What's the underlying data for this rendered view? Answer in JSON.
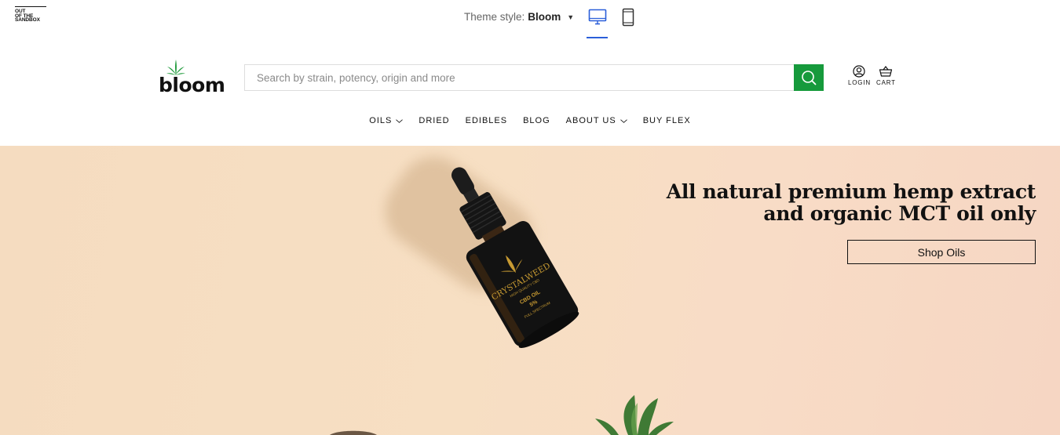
{
  "theme_bar": {
    "logo_lines": [
      "OUT",
      "OF THE",
      "SANDBOX"
    ],
    "theme_label": "Theme style:",
    "theme_value": "Bloom",
    "devices": [
      "desktop-icon",
      "mobile-icon"
    ],
    "accent": "#2b5fd9"
  },
  "header": {
    "logo_text": "bloom",
    "search": {
      "placeholder": "Search by strain, potency, origin and more"
    },
    "brand_green": "#169a3c",
    "login_label": "LOGIN",
    "cart_label": "CART"
  },
  "nav": {
    "items": [
      {
        "label": "OILS",
        "has_dropdown": true
      },
      {
        "label": "DRIED",
        "has_dropdown": false
      },
      {
        "label": "EDIBLES",
        "has_dropdown": false
      },
      {
        "label": "BLOG",
        "has_dropdown": false
      },
      {
        "label": "ABOUT US",
        "has_dropdown": true
      },
      {
        "label": "BUY FLEX",
        "has_dropdown": false
      }
    ]
  },
  "hero": {
    "heading": "All natural premium hemp extract and organic MCT oil only",
    "cta_label": "Shop Oils",
    "bottle_label_brand": "CRYSTALWEED",
    "bottle_label_sub": "HIGH QUALITY CBD",
    "bottle_label_product": "CBD OIL",
    "bottle_label_percent": "5%",
    "bottle_label_spectrum": "FULL SPECTRUM"
  }
}
